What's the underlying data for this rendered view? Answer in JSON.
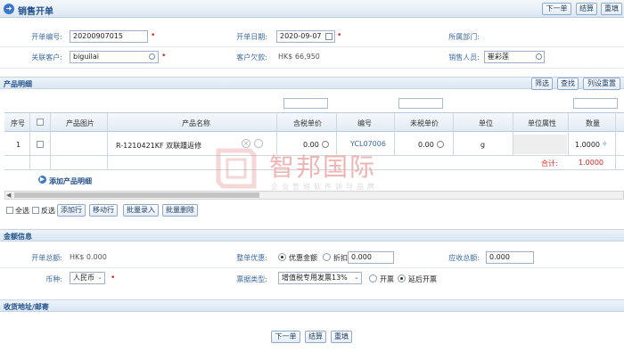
{
  "header": {
    "title": "销售开单",
    "buttons": {
      "next": "下一单",
      "settle": "结算",
      "refill": "重填"
    }
  },
  "form": {
    "order_no_label": "开单编号:",
    "order_no": "20200907015",
    "date_label": "开单日期:",
    "date": "2020-09-07",
    "dept_label": "所属部门:",
    "customer_label": "关联客户:",
    "customer": "biguilai",
    "owed_label": "客户欠款:",
    "owed": "HK$ 66,950",
    "sales_label": "销售人员:",
    "sales": "崔彩莲"
  },
  "products": {
    "section_title": "产品明细",
    "buttons": {
      "filter": "筛选",
      "search": "查找",
      "reset_columns": "列设重置"
    },
    "columns": [
      "序号",
      "",
      "产品图片",
      "产品名称",
      "含税单价",
      "编号",
      "未税单价",
      "单位",
      "单位属性",
      "数量"
    ],
    "rows": [
      {
        "index": "1",
        "name": "R-1210421KF 双联踵返修",
        "tax_price": "0.00",
        "code": "YCL07006",
        "net_price": "0.00",
        "unit": "g",
        "unit_attr": "",
        "qty": "1.0000"
      }
    ],
    "total_label": "合计:",
    "total_qty": "1.0000",
    "add_detail": "添加产品明细",
    "select_all": "全选",
    "invert": "反选",
    "toolbar": [
      "添加行",
      "移动行",
      "批量录入",
      "批量删除"
    ]
  },
  "amount": {
    "section_title": "金额信息",
    "total_label": "开单总额:",
    "total": "HK$ 0.000",
    "discount_label": "整单优惠:",
    "discount_opt1": "优惠金额",
    "discount_opt2": "折扣",
    "discount_value": "0.000",
    "receivable_label": "应收总额:",
    "receivable": "0.000",
    "currency_label": "币种:",
    "currency": "人民币",
    "invoice_label": "票据类型:",
    "invoice": "增值税专用发票13%",
    "invoice_opt1": "开票",
    "invoice_opt2": "延后开票"
  },
  "shipping": {
    "section_title": "收货地址/邮寄"
  },
  "footer": {
    "next": "下一单",
    "settle": "结算",
    "refill": "重填"
  },
  "watermark": {
    "big": "智邦国际",
    "small": "企业管理软件领导品牌"
  }
}
